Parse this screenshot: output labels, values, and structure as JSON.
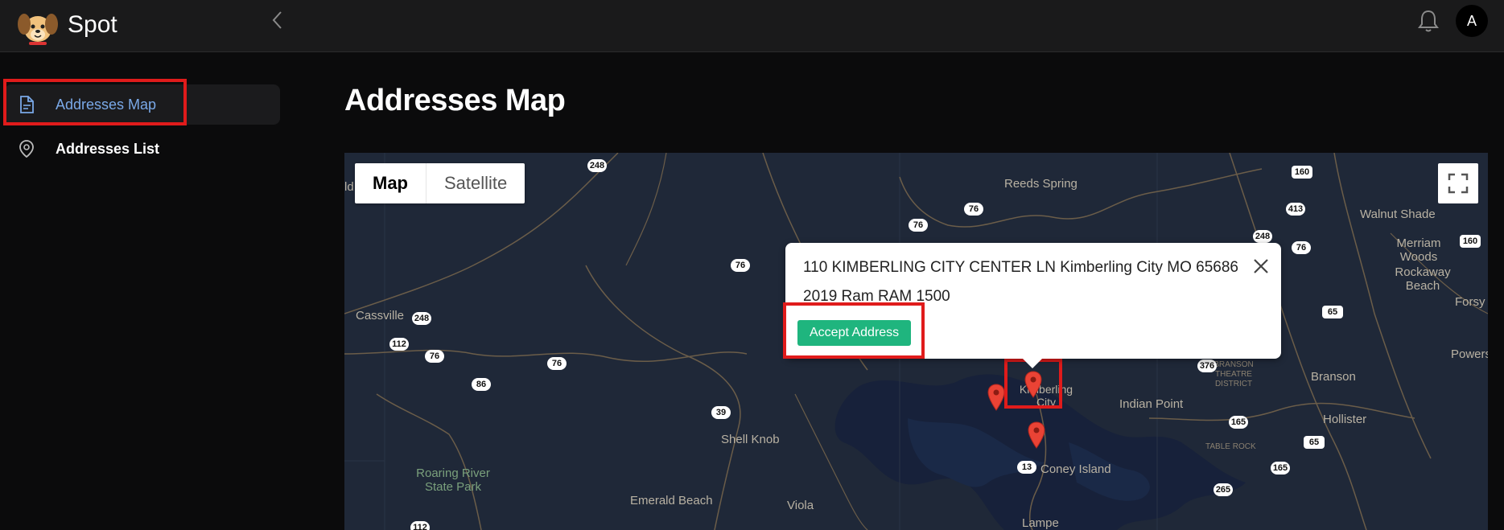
{
  "app": {
    "name": "Spot",
    "avatar_initial": "A"
  },
  "sidebar": {
    "items": [
      {
        "label": "Addresses Map",
        "icon": "document-icon",
        "active": true
      },
      {
        "label": "Addresses List",
        "icon": "location-pin-icon",
        "active": false
      }
    ]
  },
  "main": {
    "title": "Addresses Map"
  },
  "map": {
    "type_options": [
      "Map",
      "Satellite"
    ],
    "selected_type": "Map",
    "popup": {
      "address": "110 KIMBERLING CITY CENTER LN Kimberling City MO 65686",
      "vehicle": "2019 Ram RAM 1500",
      "accept_label": "Accept Address"
    },
    "places": {
      "reeds_spring": "Reeds Spring",
      "walnut_shade": "Walnut Shade",
      "merriam_woods": "Merriam Woods",
      "rockaway_beach": "Rockaway Beach",
      "cassville": "Cassville",
      "forsyth": "Forsy",
      "powersite": "Powers",
      "branson": "Branson",
      "hollister": "Hollister",
      "indian_point": "Indian Point",
      "kimberling": "Kimberling City",
      "shell_knob": "Shell Knob",
      "coney_island": "Coney Island",
      "roaring_river": "Roaring River State Park",
      "emerald_beach": "Emerald Beach",
      "viola": "Viola",
      "lampe": "Lampe",
      "branson_district": "BRANSON THEATRE DISTRICT",
      "table_rock": "TABLE ROCK",
      "edge_label": "ld"
    },
    "route_shields": [
      "248",
      "76",
      "76",
      "413",
      "248",
      "160",
      "160",
      "76",
      "76",
      "248",
      "112",
      "76",
      "86",
      "76",
      "39",
      "376",
      "65",
      "165",
      "65",
      "165",
      "265",
      "13",
      "112"
    ]
  },
  "colors": {
    "accent": "#7aa9e8",
    "accept": "#1fb57e",
    "highlight": "#e01b1b",
    "map_bg": "#1f2838"
  }
}
